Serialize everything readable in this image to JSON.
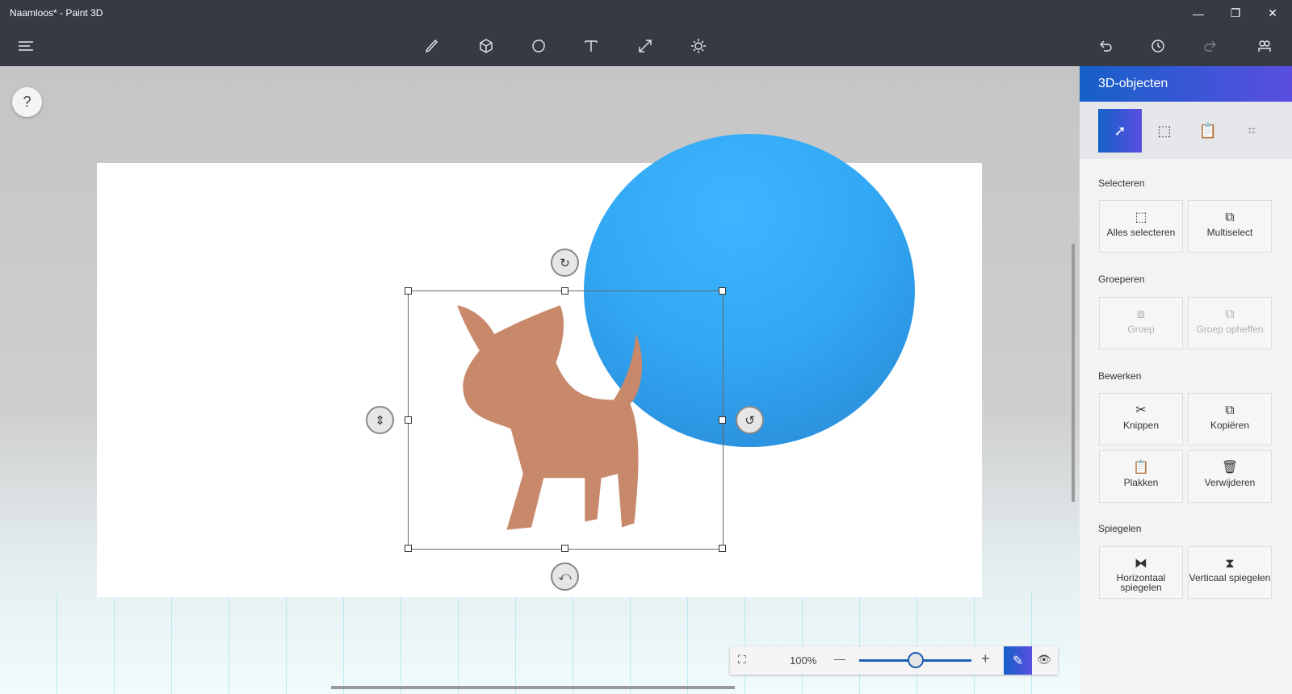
{
  "window": {
    "title": "Naamloos* - Paint 3D",
    "minimize": "—",
    "restore": "❐",
    "close": "✕"
  },
  "toolbar": {
    "menu": "menu-icon",
    "tools": [
      "brushes",
      "3d-shapes",
      "stickers",
      "text",
      "canvas",
      "effects"
    ],
    "right": [
      "undo",
      "history",
      "redo",
      "remix3d"
    ]
  },
  "help": "?",
  "panel": {
    "title": "3D-objecten",
    "sections": {
      "select": "Selecteren",
      "group": "Groeperen",
      "edit": "Bewerken",
      "mirror": "Spiegelen"
    },
    "buttons": {
      "select_all": "Alles selecteren",
      "multiselect": "Multiselect",
      "group": "Groep",
      "ungroup": "Groep opheffen",
      "cut": "Knippen",
      "copy": "Kopiëren",
      "paste": "Plakken",
      "delete": "Verwijderen",
      "flip_h": "Horizontaal spiegelen",
      "flip_v": "Verticaal spiegelen"
    }
  },
  "zoom": {
    "label": "100%",
    "minus": "—",
    "plus": "+",
    "value_percent": 100,
    "slider_fraction": 0.5
  },
  "colors": {
    "accent": "#1560c8",
    "sphere": "#33a9f5",
    "cat": "#c8896a"
  }
}
